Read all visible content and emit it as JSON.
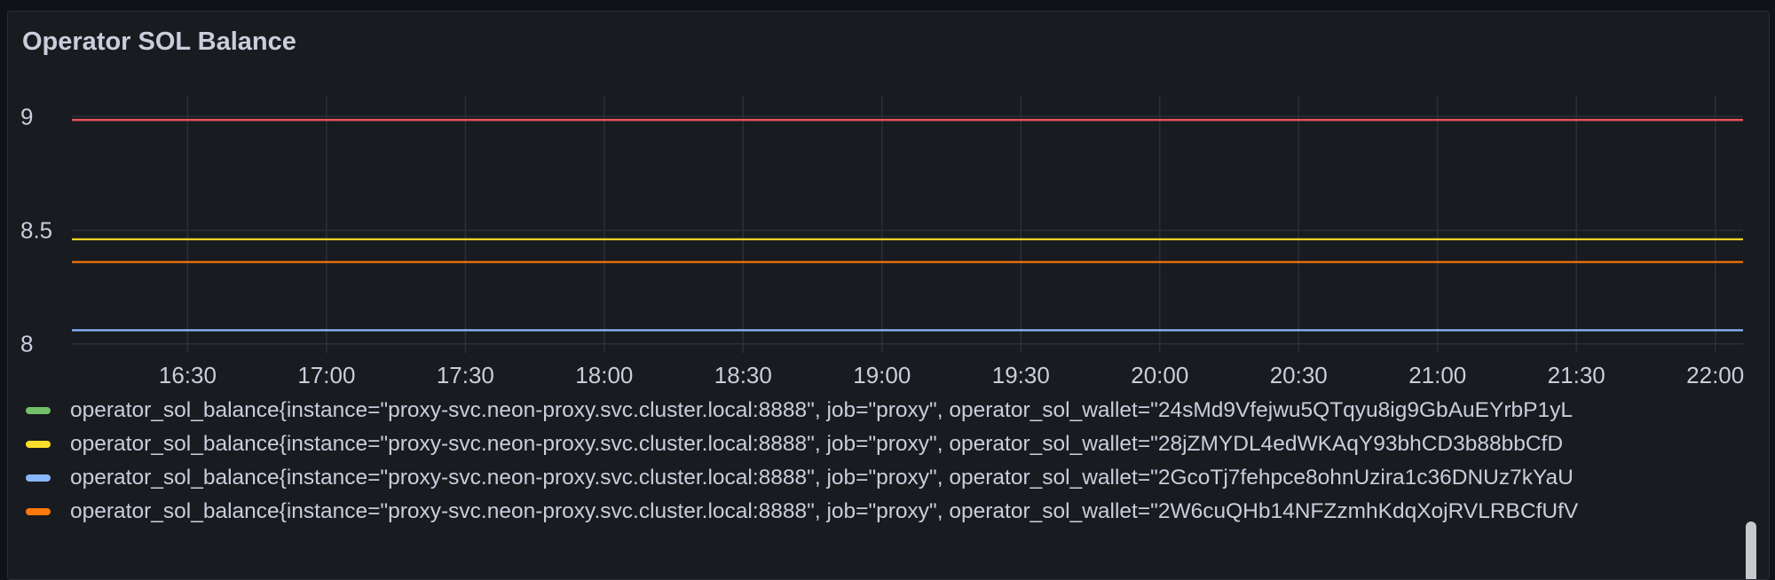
{
  "panel": {
    "title": "Operator SOL Balance"
  },
  "chart_data": {
    "type": "line",
    "title": "Operator SOL Balance",
    "xlabel": "",
    "ylabel": "",
    "x_ticks": [
      "16:30",
      "17:00",
      "17:30",
      "18:00",
      "18:30",
      "19:00",
      "19:30",
      "20:00",
      "20:30",
      "21:00",
      "21:30",
      "22:00"
    ],
    "x_range": [
      "16:05",
      "22:06"
    ],
    "y_ticks": [
      "8",
      "8.5",
      "9"
    ],
    "ylim": [
      7.96,
      9.06
    ],
    "grid": true,
    "legend_position": "bottom",
    "series": [
      {
        "name": "operator_sol_balance{instance=\"proxy-svc.neon-proxy.svc.cluster.local:8888\", job=\"proxy\", operator_sol_wallet=\"24sMd9Vfejwu5QTqyu8ig9GbAuEYrbP1yL",
        "color": "#73bf69",
        "values": [
          8.985,
          8.985
        ]
      },
      {
        "name": "operator_sol_balance{instance=\"proxy-svc.neon-proxy.svc.cluster.local:8888\", job=\"proxy\", operator_sol_wallet=\"28jZMYDL4edWKAqY93bhCD3b88bbCfD",
        "color": "#fade2a",
        "values": [
          8.46,
          8.46
        ]
      },
      {
        "name": "operator_sol_balance{instance=\"proxy-svc.neon-proxy.svc.cluster.local:8888\", job=\"proxy\", operator_sol_wallet=\"2GcoTj7fehpce8ohnUzira1c36DNUz7kYaU",
        "color": "#8ab8ff",
        "values": [
          8.06,
          8.06
        ]
      },
      {
        "name": "operator_sol_balance{instance=\"proxy-svc.neon-proxy.svc.cluster.local:8888\", job=\"proxy\", operator_sol_wallet=\"2W6cuQHb14NFZzmhKdqXojRVLRBCfUfV",
        "color": "#ff780a",
        "values": [
          8.36,
          8.36
        ]
      },
      {
        "name": "",
        "color": "#f2495c",
        "values": [
          8.985,
          8.985
        ]
      }
    ]
  }
}
